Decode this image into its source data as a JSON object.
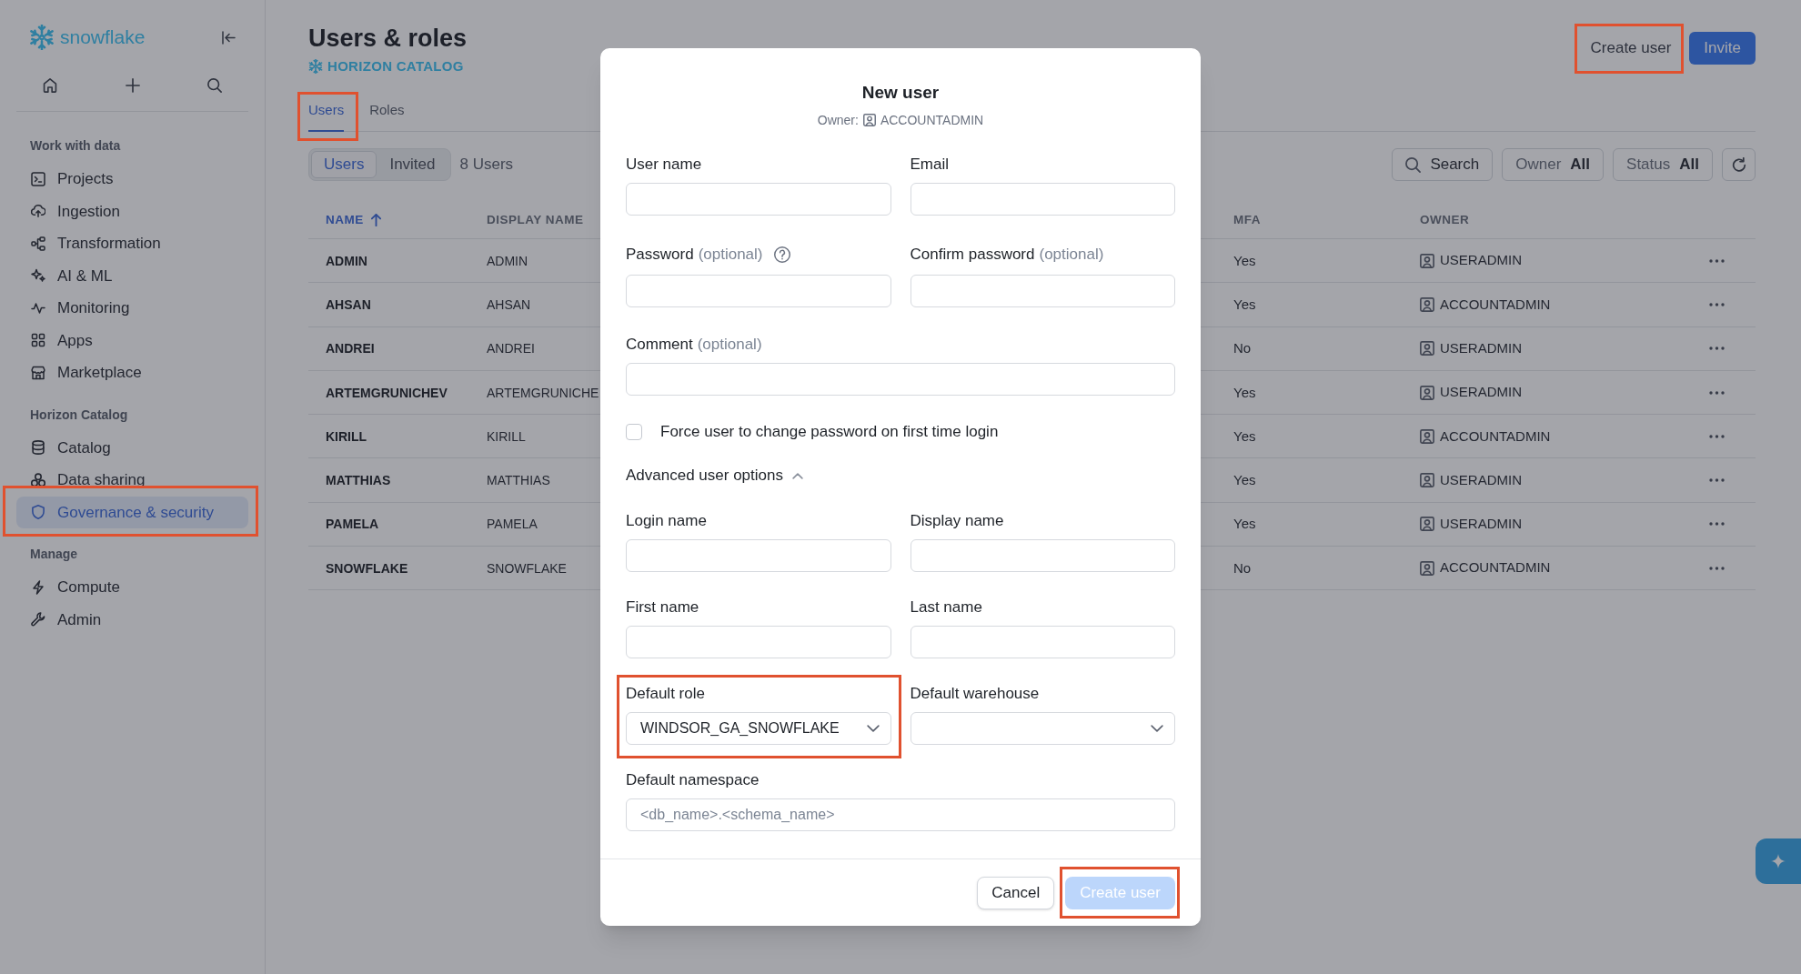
{
  "sidebar": {
    "logo": "snowflake",
    "sections": [
      {
        "title": "Work with data",
        "items": [
          {
            "label": "Projects",
            "selected": false
          },
          {
            "label": "Ingestion",
            "selected": false
          },
          {
            "label": "Transformation",
            "selected": false
          },
          {
            "label": "AI & ML",
            "selected": false
          },
          {
            "label": "Monitoring",
            "selected": false
          },
          {
            "label": "Apps",
            "selected": false
          },
          {
            "label": "Marketplace",
            "selected": false
          }
        ]
      },
      {
        "title": "Horizon Catalog",
        "items": [
          {
            "label": "Catalog",
            "selected": false
          },
          {
            "label": "Data sharing",
            "selected": false
          },
          {
            "label": "Governance & security",
            "selected": true,
            "annotated": true
          }
        ]
      },
      {
        "title": "Manage",
        "items": [
          {
            "label": "Compute",
            "selected": false
          },
          {
            "label": "Admin",
            "selected": false
          }
        ]
      }
    ]
  },
  "header": {
    "title": "Users & roles",
    "subtitle": "HORIZON CATALOG",
    "actions": [
      {
        "label": "Create user",
        "kind": "secondary",
        "annotated": true
      },
      {
        "label": "Invite",
        "kind": "primary"
      }
    ]
  },
  "tabs": [
    {
      "label": "Users",
      "selected": true,
      "annotated": true
    },
    {
      "label": "Roles",
      "selected": false
    }
  ],
  "toolbar": {
    "view_switch": [
      {
        "label": "Users",
        "selected": true
      },
      {
        "label": "Invited",
        "selected": false
      }
    ],
    "count": "8 Users",
    "search": {
      "label": "Search"
    },
    "filters": [
      {
        "label": "Owner",
        "value": "All"
      },
      {
        "label": "Status",
        "value": "All"
      }
    ]
  },
  "table": {
    "columns": [
      {
        "label": "NAME",
        "sorted": true
      },
      {
        "label": "DISPLAY NAME",
        "sorted": false
      },
      {
        "label": "MFA",
        "sorted": false
      },
      {
        "label": "OWNER",
        "sorted": false
      }
    ],
    "rows": [
      {
        "name": "ADMIN",
        "display_name": "ADMIN",
        "mfa": "Yes",
        "owner": "USERADMIN"
      },
      {
        "name": "AHSAN",
        "display_name": "AHSAN",
        "mfa": "Yes",
        "owner": "ACCOUNTADMIN"
      },
      {
        "name": "ANDREI",
        "display_name": "ANDREI",
        "mfa": "No",
        "owner": "USERADMIN"
      },
      {
        "name": "ARTEMGRUNICHEV",
        "display_name": "ARTEMGRUNICHE",
        "mfa": "Yes",
        "owner": "USERADMIN"
      },
      {
        "name": "KIRILL",
        "display_name": "KIRILL",
        "mfa": "Yes",
        "owner": "ACCOUNTADMIN"
      },
      {
        "name": "MATTHIAS",
        "display_name": "MATTHIAS",
        "mfa": "Yes",
        "owner": "USERADMIN"
      },
      {
        "name": "PAMELA",
        "display_name": "PAMELA",
        "mfa": "Yes",
        "owner": "USERADMIN"
      },
      {
        "name": "SNOWFLAKE",
        "display_name": "SNOWFLAKE",
        "mfa": "No",
        "owner": "ACCOUNTADMIN"
      }
    ]
  },
  "dialog": {
    "title": "New user",
    "owner_label": "Owner:",
    "owner": "ACCOUNTADMIN",
    "rows": [
      [
        {
          "kind": "text",
          "label": "User name"
        },
        {
          "kind": "text",
          "label": "Email"
        }
      ],
      [
        {
          "kind": "text",
          "label": "Password",
          "note": "(optional)",
          "help": true
        },
        {
          "kind": "text",
          "label": "Confirm password",
          "note": "(optional)"
        }
      ],
      [
        {
          "kind": "text",
          "label": "Comment",
          "note": "(optional)"
        }
      ],
      [
        {
          "kind": "checkbox",
          "label": "Force user to change password on first time login",
          "checked": false
        }
      ]
    ],
    "advanced": {
      "label": "Advanced user options",
      "expanded": true,
      "rows": [
        [
          {
            "kind": "text",
            "label": "Login name"
          },
          {
            "kind": "text",
            "label": "Display name"
          }
        ],
        [
          {
            "kind": "text",
            "label": "First name"
          },
          {
            "kind": "text",
            "label": "Last name"
          }
        ],
        [
          {
            "kind": "select",
            "label": "Default role",
            "value": "WINDSOR_GA_SNOWFLAKE",
            "annotated": true
          },
          {
            "kind": "select",
            "label": "Default warehouse"
          }
        ],
        [
          {
            "kind": "text",
            "label": "Default namespace",
            "placeholder": "<db_name>.<schema_name>"
          }
        ]
      ]
    },
    "buttons": [
      {
        "label": "Cancel",
        "kind": "secondary",
        "disabled": false
      },
      {
        "label": "Create user",
        "kind": "primary",
        "disabled": true,
        "annotated": true
      }
    ]
  }
}
